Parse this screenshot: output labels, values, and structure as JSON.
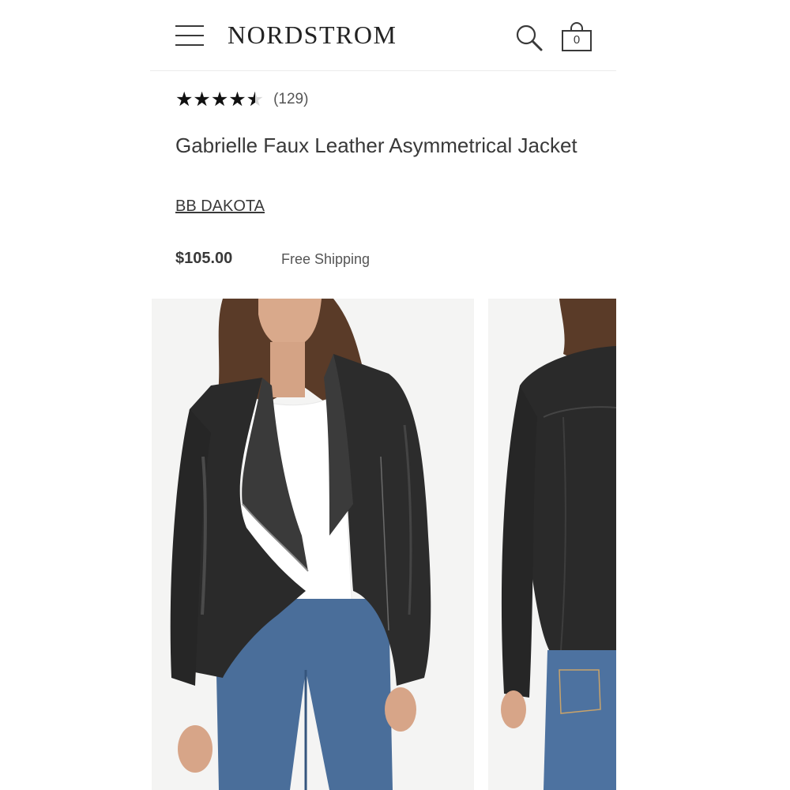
{
  "header": {
    "logo": "NORDSTROM",
    "menu_icon": "hamburger-menu-icon",
    "search_icon": "search-icon",
    "bag_icon": "shopping-bag-icon",
    "bag_count": "0"
  },
  "product": {
    "rating": {
      "stars": 4.5,
      "max_stars": 5,
      "count_label": "(129)"
    },
    "title": "Gabrielle Faux Leather Asymmetrical Jacket",
    "brand": "BB DAKOTA",
    "price": "$105.00",
    "shipping": "Free Shipping"
  },
  "images": [
    {
      "view": "front"
    },
    {
      "view": "back"
    }
  ],
  "colors": {
    "text": "#393939",
    "star": "#111111",
    "star_empty": "#d8d8d8",
    "jacket": "#2a2a2a",
    "denim": "#4a6e9a"
  }
}
